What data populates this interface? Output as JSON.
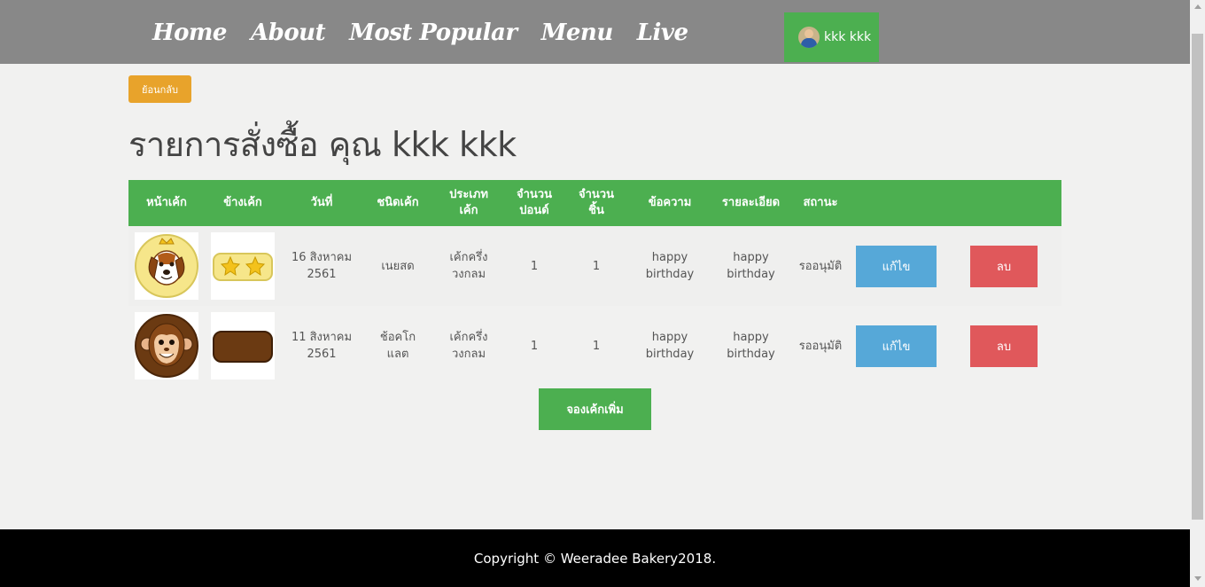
{
  "nav": {
    "links": [
      "Home",
      "About",
      "Most Popular",
      "Menu",
      "Live"
    ],
    "user_name": "kkk kkk"
  },
  "back_label": "ย้อนกลับ",
  "page_title": "รายการสั่งซื้อ คุณ kkk kkk",
  "table": {
    "headers": [
      "หน้าเค้ก",
      "ข้างเค้ก",
      "วันที่",
      "ชนิดเค้ก",
      "ประเภท\nเค้ก",
      "จำนวน\nปอนด์",
      "จำนวน\nชิ้น",
      "ข้อความ",
      "รายละเอียด",
      "สถานะ"
    ],
    "rows": [
      {
        "face_icon": "dog-face-crown-icon",
        "side_icon": "yellow-stars-icon",
        "date": "16 สิงหาคม\n2561",
        "cake_type": "เนยสด",
        "category": "เค้กครึ่ง\nวงกลม",
        "pounds": "1",
        "pieces": "1",
        "message": "happy\nbirthday",
        "details": "happy\nbirthday",
        "status": "รออนุมัติ",
        "edit_label": "แก้ไข",
        "delete_label": "ลบ"
      },
      {
        "face_icon": "monkey-face-icon",
        "side_icon": "chocolate-bar-icon",
        "date": "11 สิงหาคม\n2561",
        "cake_type": "ช้อคโก\nแลต",
        "category": "เค้กครึ่ง\nวงกลม",
        "pounds": "1",
        "pieces": "1",
        "message": "happy\nbirthday",
        "details": "happy\nbirthday",
        "status": "รออนุมัติ",
        "edit_label": "แก้ไข",
        "delete_label": "ลบ"
      }
    ]
  },
  "add_label": "จองเค้กเพิ่ม",
  "footer_text": "Copyright © Weeradee Bakery2018.",
  "colors": {
    "nav_bg": "#888888",
    "accent_green": "#4caf50",
    "back_orange": "#e8a32b",
    "edit_blue": "#56a8d8",
    "delete_red": "#e0585b"
  }
}
